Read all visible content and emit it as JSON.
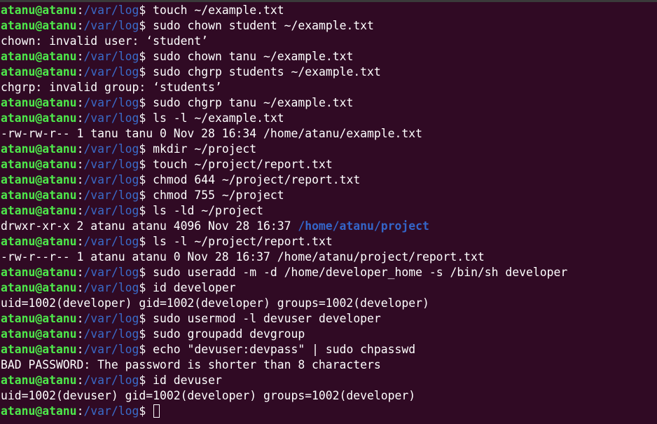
{
  "prompt": {
    "user_host": "atanu@atanu",
    "separator": ":",
    "path": "/var/log",
    "symbol": "$ "
  },
  "lines": [
    {
      "type": "cmd",
      "text": "touch ~/example.txt"
    },
    {
      "type": "cmd",
      "text": "sudo chown student ~/example.txt"
    },
    {
      "type": "out",
      "text": "chown: invalid user: ‘student’"
    },
    {
      "type": "cmd",
      "text": "sudo chown tanu ~/example.txt"
    },
    {
      "type": "cmd",
      "text": "sudo chgrp students ~/example.txt"
    },
    {
      "type": "out",
      "text": "chgrp: invalid group: ‘students’"
    },
    {
      "type": "cmd",
      "text": "sudo chgrp tanu ~/example.txt"
    },
    {
      "type": "cmd",
      "text": "ls -l ~/example.txt"
    },
    {
      "type": "out",
      "text": "-rw-rw-r-- 1 tanu tanu 0 Nov 28 16:34 /home/atanu/example.txt"
    },
    {
      "type": "cmd",
      "text": "mkdir ~/project"
    },
    {
      "type": "cmd",
      "text": "touch ~/project/report.txt"
    },
    {
      "type": "cmd",
      "text": "chmod 644 ~/project/report.txt"
    },
    {
      "type": "cmd",
      "text": "chmod 755 ~/project"
    },
    {
      "type": "cmd",
      "text": "ls -ld ~/project"
    },
    {
      "type": "out_dir",
      "text": "drwxr-xr-x 2 atanu atanu 4096 Nov 28 16:37 ",
      "dir": "/home/atanu/project"
    },
    {
      "type": "cmd",
      "text": "ls -l ~/project/report.txt"
    },
    {
      "type": "out",
      "text": "-rw-r--r-- 1 atanu atanu 0 Nov 28 16:37 /home/atanu/project/report.txt"
    },
    {
      "type": "cmd",
      "text": "sudo useradd -m -d /home/developer_home -s /bin/sh developer"
    },
    {
      "type": "cmd",
      "text": "id developer"
    },
    {
      "type": "out",
      "text": "uid=1002(developer) gid=1002(developer) groups=1002(developer)"
    },
    {
      "type": "cmd",
      "text": "sudo usermod -l devuser developer"
    },
    {
      "type": "cmd",
      "text": "sudo groupadd devgroup"
    },
    {
      "type": "cmd",
      "text": "echo \"devuser:devpass\" | sudo chpasswd"
    },
    {
      "type": "out",
      "text": "BAD PASSWORD: The password is shorter than 8 characters"
    },
    {
      "type": "cmd",
      "text": "id devuser"
    },
    {
      "type": "out",
      "text": "uid=1002(devuser) gid=1002(developer) groups=1002(developer)"
    },
    {
      "type": "prompt",
      "text": ""
    }
  ],
  "colors": {
    "background": "#300a24",
    "user_host": "#4ee94b",
    "path": "#3a6bc9",
    "text": "#ffffff",
    "directory": "#3465c8"
  }
}
